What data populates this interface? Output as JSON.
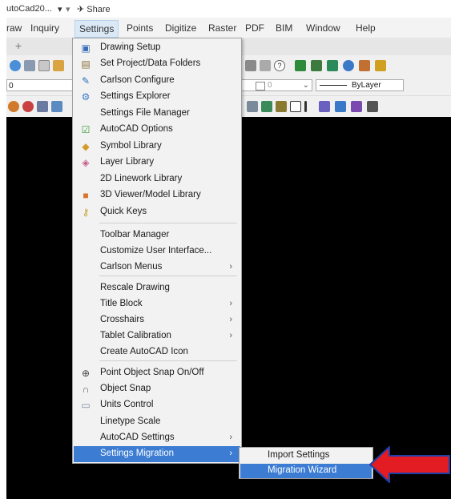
{
  "titlebar": {
    "app_title": "utoCad20...",
    "qat_dropdown": "▾",
    "share_label": "Share"
  },
  "menubar": {
    "items": [
      {
        "label": "raw"
      },
      {
        "label": "Inquiry"
      },
      {
        "label": "Settings"
      },
      {
        "label": "Points"
      },
      {
        "label": "Digitize"
      },
      {
        "label": "Raster"
      },
      {
        "label": "PDF"
      },
      {
        "label": "BIM"
      },
      {
        "label": "Window"
      },
      {
        "label": "Help"
      }
    ]
  },
  "tabs": {
    "new_tab": "+"
  },
  "toolbar": {
    "layer_value": "0",
    "color_value": "0",
    "linetype_value": "ByLayer"
  },
  "settings_menu": {
    "items": [
      {
        "label": "Drawing Setup",
        "icon": "drawing-setup-icon",
        "glyph": "▣",
        "color": "#3a6fb8"
      },
      {
        "label": "Set Project/Data Folders",
        "icon": "folder-icon",
        "glyph": "▤",
        "color": "#8a6d3b"
      },
      {
        "label": "Carlson Configure",
        "icon": "wrench-icon",
        "glyph": "✎",
        "color": "#2f6fc0"
      },
      {
        "label": "Settings Explorer",
        "icon": "gears-icon",
        "glyph": "⚙",
        "color": "#3a78c8"
      },
      {
        "label": "Settings File Manager",
        "icon": "",
        "glyph": "",
        "color": ""
      },
      {
        "label": "AutoCAD Options",
        "icon": "checkbox-icon",
        "glyph": "☑",
        "color": "#3a9a3a"
      },
      {
        "label": "Symbol Library",
        "icon": "symbol-library-icon",
        "glyph": "◆",
        "color": "#d49a2a"
      },
      {
        "label": "Layer Library",
        "icon": "layer-library-icon",
        "glyph": "◈",
        "color": "#c85a8a"
      },
      {
        "label": "2D Linework Library",
        "icon": "",
        "glyph": "",
        "color": ""
      },
      {
        "label": "3D Viewer/Model Library",
        "icon": "3d-viewer-icon",
        "glyph": "■",
        "color": "#d8742a"
      },
      {
        "label": "Quick Keys",
        "icon": "key-icon",
        "glyph": "⚷",
        "color": "#c8a02a"
      },
      {
        "label": "Toolbar Manager",
        "icon": "",
        "glyph": "",
        "color": ""
      },
      {
        "label": "Customize User Interface...",
        "icon": "",
        "glyph": "",
        "color": ""
      },
      {
        "label": "Carlson Menus",
        "icon": "",
        "glyph": "",
        "color": "",
        "submenu": "›"
      },
      {
        "label": "Rescale Drawing",
        "icon": "",
        "glyph": "",
        "color": ""
      },
      {
        "label": "Title Block",
        "icon": "",
        "glyph": "",
        "color": "",
        "submenu": "›"
      },
      {
        "label": "Crosshairs",
        "icon": "",
        "glyph": "",
        "color": "",
        "submenu": "›"
      },
      {
        "label": "Tablet Calibration",
        "icon": "",
        "glyph": "",
        "color": "",
        "submenu": "›"
      },
      {
        "label": "Create AutoCAD Icon",
        "icon": "",
        "glyph": "",
        "color": ""
      },
      {
        "label": "Point Object Snap On/Off",
        "icon": "snap-target-icon",
        "glyph": "⊕",
        "color": "#444444"
      },
      {
        "label": "Object Snap",
        "icon": "magnet-icon",
        "glyph": "∩",
        "color": "#555555"
      },
      {
        "label": "Units Control",
        "icon": "units-icon",
        "glyph": "▭",
        "color": "#7a8aa0"
      },
      {
        "label": "Linetype Scale",
        "icon": "",
        "glyph": "",
        "color": ""
      },
      {
        "label": "AutoCAD Settings",
        "icon": "",
        "glyph": "",
        "color": "",
        "submenu": "›"
      },
      {
        "label": "Settings Migration",
        "icon": "",
        "glyph": "",
        "color": "",
        "submenu": "›"
      }
    ]
  },
  "migration_submenu": {
    "items": [
      {
        "label": "Import Settings"
      },
      {
        "label": "Migration Wizard"
      }
    ]
  },
  "colors": {
    "highlight": "#3c7dd3",
    "arrow": "#e31b23",
    "arrow_outline": "#1c3fa8",
    "canvas": "#000000"
  }
}
